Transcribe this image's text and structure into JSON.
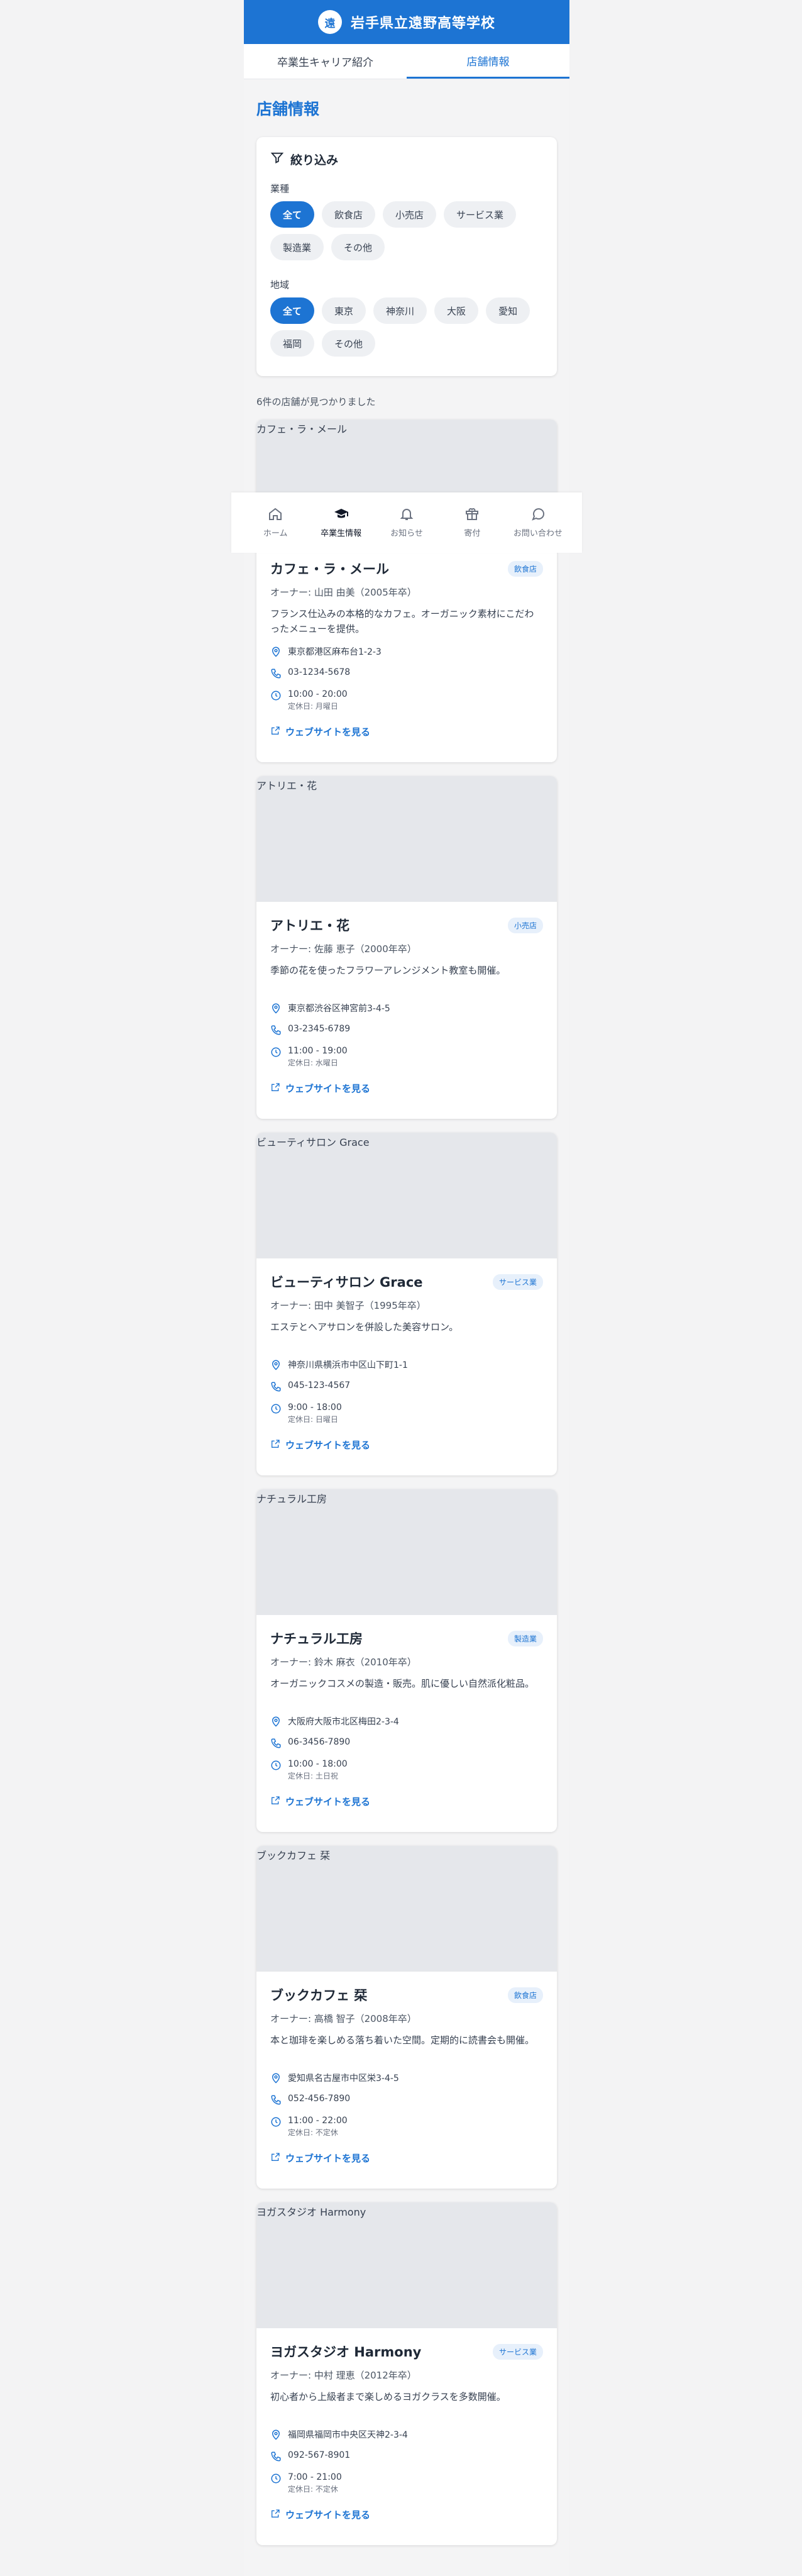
{
  "header": {
    "logo": "遠",
    "school": "岩手県立遠野高等学校"
  },
  "tabs": [
    {
      "label": "卒業生キャリア紹介",
      "active": false
    },
    {
      "label": "店舗情報",
      "active": true
    }
  ],
  "page": {
    "title": "店舗情報"
  },
  "filter": {
    "title": "絞り込み",
    "industry_label": "業種",
    "industries": [
      "全て",
      "飲食店",
      "小売店",
      "サービス業",
      "製造業",
      "その他"
    ],
    "region_label": "地域",
    "regions": [
      "全て",
      "東京",
      "神奈川",
      "大阪",
      "愛知",
      "福岡",
      "その他"
    ]
  },
  "results": "6件の店舗が見つかりました",
  "website_label": "ウェブサイトを見る",
  "stores": [
    {
      "image": "カフェ・ラ・メール",
      "name": "カフェ・ラ・メール",
      "badge": "飲食店",
      "owner": "オーナー: 山田 由美（2005年卒）",
      "desc": "フランス仕込みの本格的なカフェ。オーガニック素材にこだわったメニューを提供。",
      "address": "東京都港区麻布台1-2-3",
      "phone": "03-1234-5678",
      "hours": "10:00 - 20:00",
      "closed": "定休日: 月曜日"
    },
    {
      "image": "アトリエ・花",
      "name": "アトリエ・花",
      "badge": "小売店",
      "owner": "オーナー: 佐藤 恵子（2000年卒）",
      "desc": "季節の花を使ったフラワーアレンジメント教室も開催。",
      "address": "東京都渋谷区神宮前3-4-5",
      "phone": "03-2345-6789",
      "hours": "11:00 - 19:00",
      "closed": "定休日: 水曜日"
    },
    {
      "image": "ビューティサロン Grace",
      "name": "ビューティサロン Grace",
      "badge": "サービス業",
      "owner": "オーナー: 田中 美智子（1995年卒）",
      "desc": "エステとヘアサロンを併設した美容サロン。",
      "address": "神奈川県横浜市中区山下町1-1",
      "phone": "045-123-4567",
      "hours": "9:00 - 18:00",
      "closed": "定休日: 日曜日"
    },
    {
      "image": "ナチュラル工房",
      "name": "ナチュラル工房",
      "badge": "製造業",
      "owner": "オーナー: 鈴木 麻衣（2010年卒）",
      "desc": "オーガニックコスメの製造・販売。肌に優しい自然派化粧品。",
      "address": "大阪府大阪市北区梅田2-3-4",
      "phone": "06-3456-7890",
      "hours": "10:00 - 18:00",
      "closed": "定休日: 土日祝"
    },
    {
      "image": "ブックカフェ 栞",
      "name": "ブックカフェ 栞",
      "badge": "飲食店",
      "owner": "オーナー: 高橋 智子（2008年卒）",
      "desc": "本と珈琲を楽しめる落ち着いた空間。定期的に読書会も開催。",
      "address": "愛知県名古屋市中区栄3-4-5",
      "phone": "052-456-7890",
      "hours": "11:00 - 22:00",
      "closed": "定休日: 不定休"
    },
    {
      "image": "ヨガスタジオ Harmony",
      "name": "ヨガスタジオ Harmony",
      "badge": "サービス業",
      "owner": "オーナー: 中村 理恵（2012年卒）",
      "desc": "初心者から上級者まで楽しめるヨガクラスを多数開催。",
      "address": "福岡県福岡市中央区天神2-3-4",
      "phone": "092-567-8901",
      "hours": "7:00 - 21:00",
      "closed": "定休日: 不定休"
    }
  ],
  "bottom_nav": [
    {
      "label": "ホーム",
      "icon": "home-icon"
    },
    {
      "label": "卒業生情報",
      "icon": "graduation-cap-icon"
    },
    {
      "label": "お知らせ",
      "icon": "bell-icon"
    },
    {
      "label": "寄付",
      "icon": "gift-icon"
    },
    {
      "label": "お問い合わせ",
      "icon": "message-icon"
    }
  ]
}
